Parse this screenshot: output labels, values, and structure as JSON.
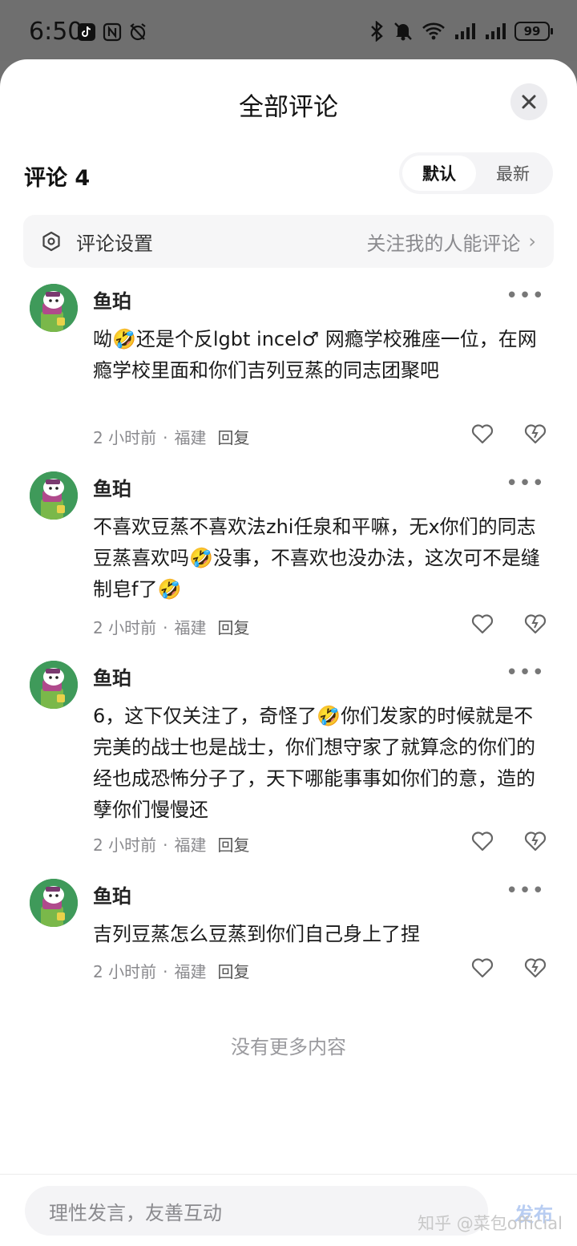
{
  "status_bar": {
    "time": "6:50",
    "battery": "99"
  },
  "header": {
    "title": "全部评论",
    "close_icon": "close-icon"
  },
  "comments_header": {
    "count_label": "评论 4",
    "sort_options": [
      "默认",
      "最新"
    ],
    "active_sort": "默认"
  },
  "settings": {
    "label": "评论设置",
    "value": "关注我的人能评论",
    "chevron": "›"
  },
  "comments": [
    {
      "author": "鱼珀",
      "body": "呦🤣还是个反lgbt incel♂ 网瘾学校雅座一位，在网瘾学校里面和你们吉列豆蒸的同志团聚吧",
      "time": "2 小时前",
      "location": "福建",
      "reply": "回复"
    },
    {
      "author": "鱼珀",
      "body": "不喜欢豆蒸不喜欢法zhi任泉和平嘛，无x你们的同志豆蒸喜欢吗🤣没事，不喜欢也没办法，这次可不是缝制皂f了🤣",
      "time": "2 小时前",
      "location": "福建",
      "reply": "回复"
    },
    {
      "author": "鱼珀",
      "body": "6，这下仅关注了，奇怪了🤣你们发家的时候就是不完美的战士也是战士，你们想守家了就算念的你们的经也成恐怖分子了，天下哪能事事如你们的意，造的孽你们慢慢还",
      "time": "2 小时前",
      "location": "福建",
      "reply": "回复"
    },
    {
      "author": "鱼珀",
      "body": "吉列豆蒸怎么豆蒸到你们自己身上了捏",
      "time": "2 小时前",
      "location": "福建",
      "reply": "回复"
    }
  ],
  "footer": {
    "no_more": "没有更多内容"
  },
  "composer": {
    "placeholder": "理性发言，友善互动",
    "publish": "发布"
  },
  "watermark": "知乎 @菜包official",
  "colors": {
    "accent": "#b8cdf2",
    "avatar_bg": "#3f9a5a"
  }
}
